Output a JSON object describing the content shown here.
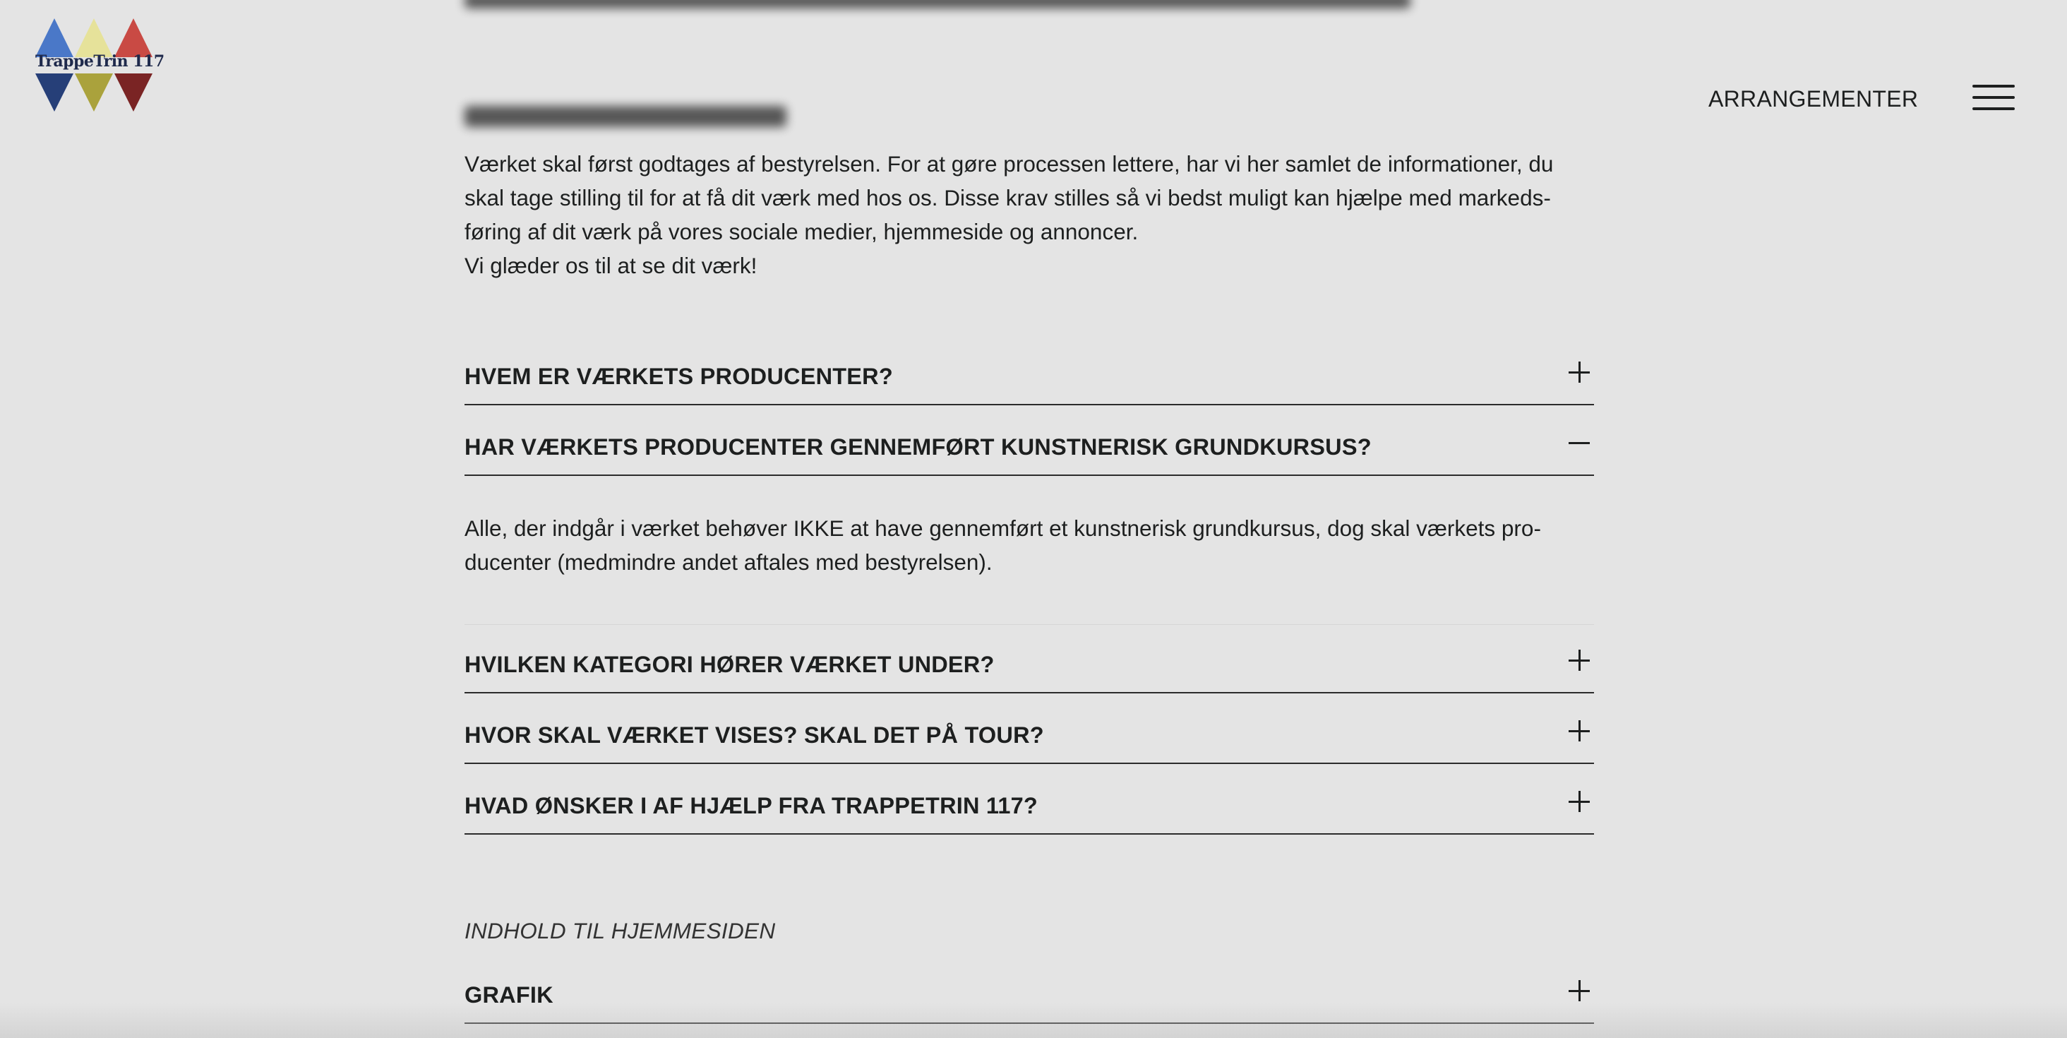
{
  "header": {
    "logo_text": "TrappeTrin 117",
    "nav_link": "ARRANGEMENTER",
    "menu_icon": "hamburger-menu-icon"
  },
  "intro": {
    "lines": [
      "Værket skal først godtages af bestyrelsen. For at gøre processen lettere, har vi her samlet de informationer, du",
      "skal tage stilling til for at få dit værk med hos os. Disse krav stilles så vi bedst muligt kan hjælpe med markeds-",
      "føring af dit værk på vores sociale medier, hjemmeside og annoncer.",
      "Vi glæder os til at se dit værk!"
    ]
  },
  "faq": [
    {
      "question": "HVEM ER VÆRKETS PRODUCENTER?",
      "expanded": false
    },
    {
      "question": "HAR VÆRKETS PRODUCENTER GENNEMFØRT KUNSTNERISK GRUNDKURSUS?",
      "expanded": true,
      "answer_lines": [
        "Alle, der indgår i værket behøver IKKE at have gennemført et kunstnerisk grundkursus, dog skal værkets pro-",
        "ducenter (medmindre andet aftales med bestyrelsen)."
      ]
    },
    {
      "question": "HVILKEN KATEGORI HØRER VÆRKET UNDER?",
      "expanded": false
    },
    {
      "question": "HVOR SKAL VÆRKET VISES? SKAL DET PÅ TOUR?",
      "expanded": false
    },
    {
      "question": "HVAD ØNSKER I AF HJÆLP FRA TRAPPETRIN 117?",
      "expanded": false
    }
  ],
  "website_section": {
    "label": "INDHOLD TIL HJEMMESIDEN",
    "items": [
      {
        "question": "GRAFIK",
        "expanded": false
      }
    ]
  },
  "icons": {
    "expand": "plus-icon",
    "collapse": "minus-icon"
  },
  "colors": {
    "background": "#e4e4e4",
    "text": "#1d1f1f",
    "logo_blue": "#4a78c8",
    "logo_yellow": "#e6e29a",
    "logo_red": "#c94a44",
    "logo_navy": "#263f78",
    "logo_olive": "#aaa23c",
    "logo_maroon": "#7a2424"
  }
}
